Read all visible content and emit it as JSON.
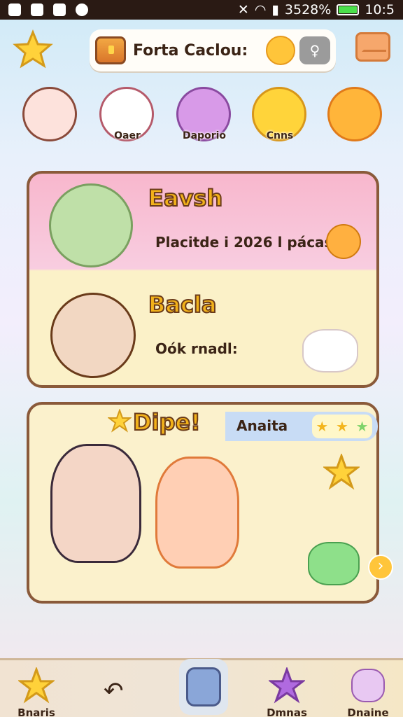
{
  "status": {
    "time": "10:5",
    "battery": "3528%"
  },
  "top": {
    "title": "Forta Caclou:"
  },
  "tabs": [
    {
      "label": ""
    },
    {
      "label": "Oaer"
    },
    {
      "label": "Daporio"
    },
    {
      "label": "Cnns"
    },
    {
      "label": ""
    }
  ],
  "card1": {
    "p1_name": "Eavsh",
    "p1_sub": "Placitde i 2026 l pácas?",
    "p2_name": "Bacla",
    "p2_sub": "Oók rnadl:"
  },
  "card2": {
    "title": "Dipe!",
    "subtitle": "Anaita",
    "stars": [
      "★",
      "★",
      "★"
    ]
  },
  "bottom": {
    "left": "Bnaris",
    "right1": "Dmnas",
    "right2": "Dnaine"
  }
}
